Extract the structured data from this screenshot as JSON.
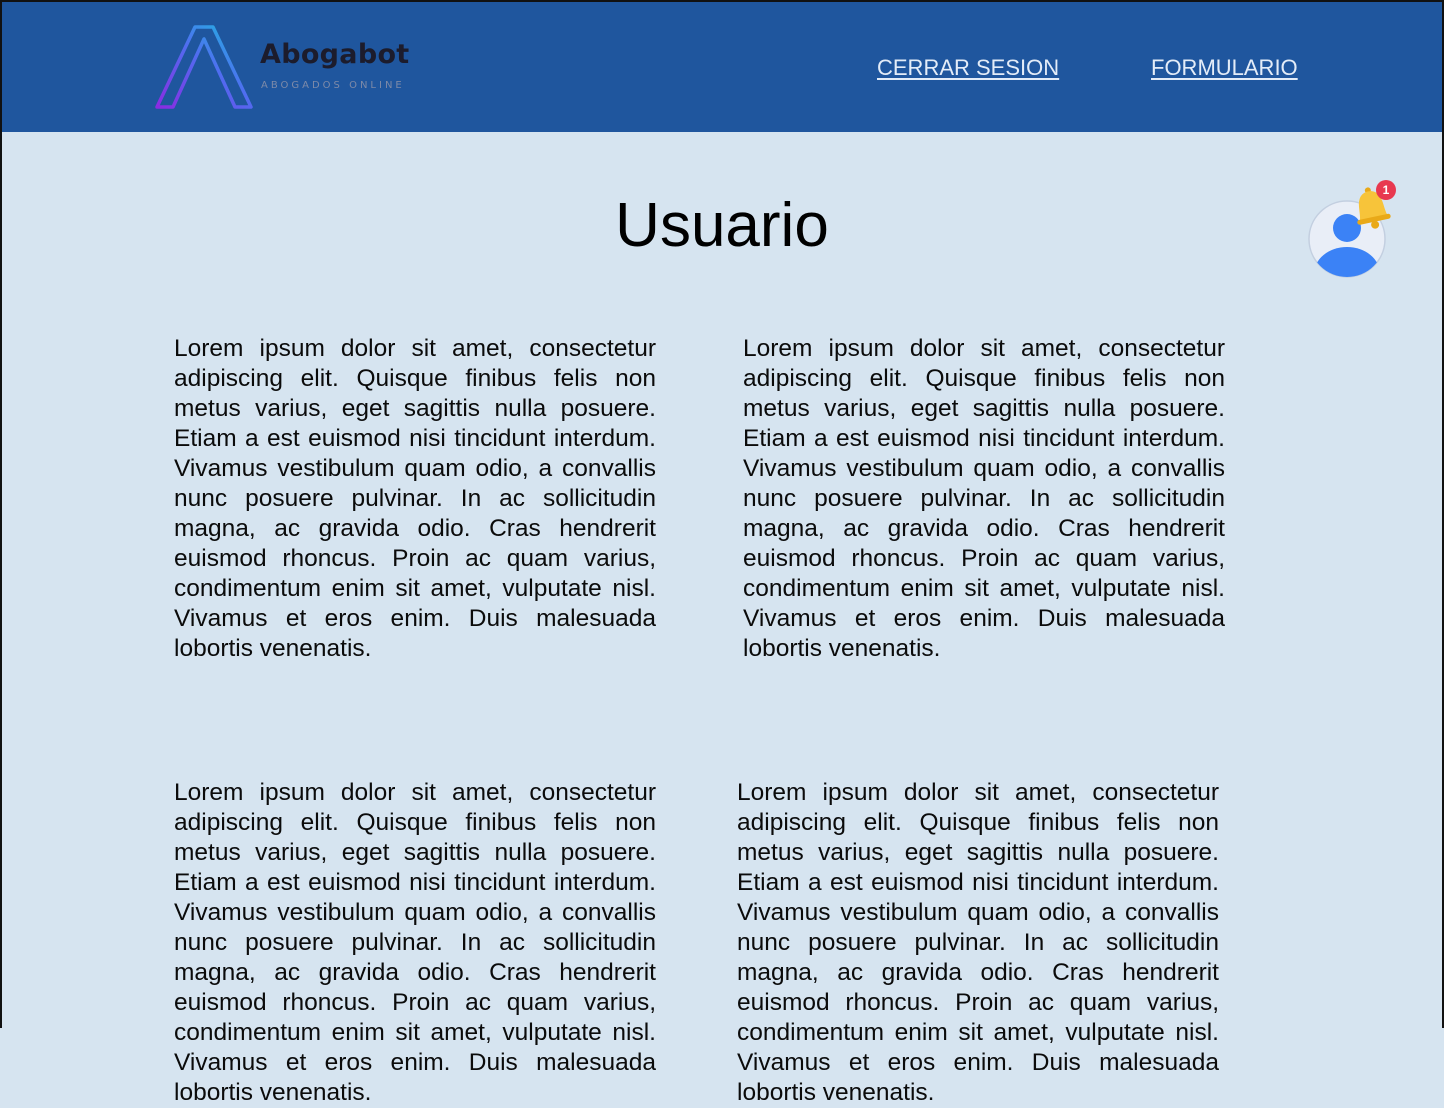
{
  "header": {
    "brand_name": "Abogabot",
    "brand_tagline": "ABOGADOS ONLINE",
    "nav": {
      "logout_label": "CERRAR SESION",
      "form_label": "FORMULARIO"
    }
  },
  "main": {
    "title": "Usuario",
    "notification_count": "1",
    "paragraphs": [
      "Lorem ipsum dolor sit amet, consectetur adipiscing elit. Quisque finibus felis non metus varius, eget sagittis nulla posuere. Etiam a est euismod nisi tincidunt interdum. Vivamus vestibulum quam odio, a convallis nunc posuere pulvinar. In ac sollicitudin magna, ac gravida odio. Cras hendrerit euismod rhoncus. Proin ac quam varius, condimentum enim sit amet, vulputate nisl. Vivamus et eros enim. Duis malesuada lobortis venenatis.",
      "Lorem ipsum dolor sit amet, consectetur adipiscing elit. Quisque finibus felis non metus varius, eget sagittis nulla posuere. Etiam a est euismod nisi tincidunt interdum. Vivamus vestibulum quam odio, a convallis nunc posuere pulvinar. In ac sollicitudin magna, ac gravida odio. Cras hendrerit euismod rhoncus. Proin ac quam varius, condimentum enim sit amet, vulputate nisl. Vivamus et eros enim. Duis malesuada lobortis venenatis.",
      "Lorem ipsum dolor sit amet, consectetur adipiscing elit. Quisque finibus felis non metus varius, eget sagittis nulla posuere. Etiam a est euismod nisi tincidunt interdum. Vivamus vestibulum quam odio, a convallis nunc posuere pulvinar. In ac sollicitudin magna, ac gravida odio. Cras hendrerit euismod rhoncus. Proin ac quam varius, condimentum enim sit amet, vulputate nisl. Vivamus et eros enim. Duis malesuada lobortis venenatis.",
      "Lorem ipsum dolor sit amet, consectetur adipiscing elit. Quisque finibus felis non metus varius, eget sagittis nulla posuere. Etiam a est euismod nisi tincidunt interdum. Vivamus vestibulum quam odio, a convallis nunc posuere pulvinar. In ac sollicitudin magna, ac gravida odio. Cras hendrerit euismod rhoncus. Proin ac quam varius, condimentum enim sit amet, vulputate nisl. Vivamus et eros enim. Duis malesuada lobortis venenatis."
    ]
  },
  "icons": {
    "logo": "abogabot-logo-icon",
    "avatar": "user-avatar-icon",
    "notification": "bell-icon"
  },
  "colors": {
    "header_bg": "#1f569e",
    "page_bg": "#d6e4f0",
    "avatar_blue": "#3b82f6",
    "bell_yellow": "#f7c43a",
    "badge_red": "#e8384f"
  }
}
